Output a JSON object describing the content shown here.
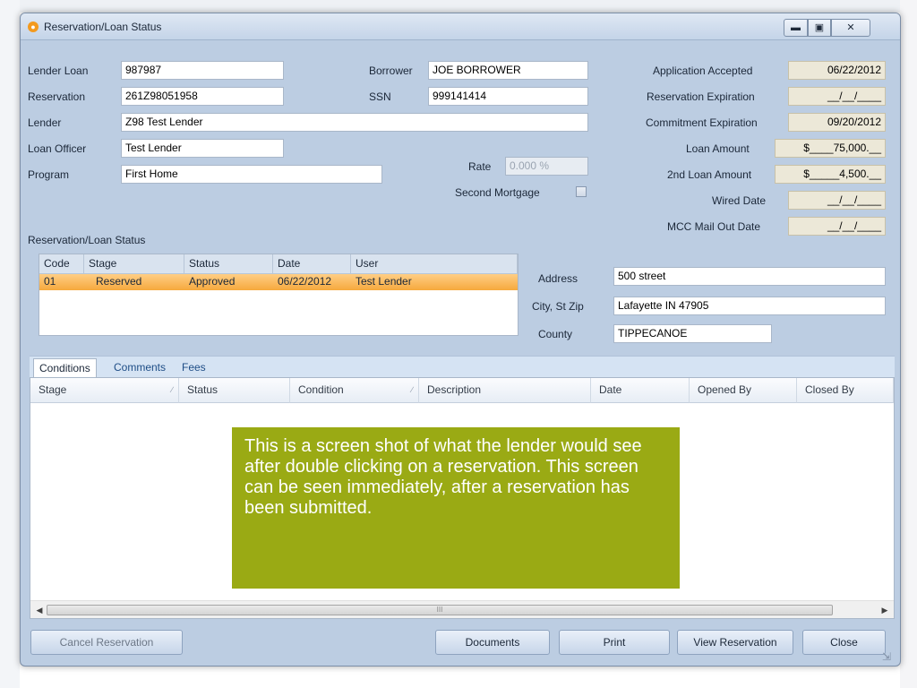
{
  "window": {
    "title": "Reservation/Loan Status",
    "controls": {
      "minimize_icon": "minimize-icon",
      "maximize_icon": "maximize-icon",
      "close_icon": "close-icon"
    }
  },
  "fields": {
    "lender_loan": {
      "label": "Lender Loan",
      "value": "987987"
    },
    "reservation": {
      "label": "Reservation",
      "value": "261Z98051958"
    },
    "lender": {
      "label": "Lender",
      "value": "Z98 Test Lender"
    },
    "loan_officer": {
      "label": "Loan Officer",
      "value": "Test Lender"
    },
    "program": {
      "label": "Program",
      "value": "First Home"
    },
    "borrower": {
      "label": "Borrower",
      "value": "JOE BORROWER"
    },
    "ssn": {
      "label": "SSN",
      "value": "999141414"
    },
    "rate": {
      "label": "Rate",
      "value": "0.000 %"
    },
    "second_mortgage": {
      "label": "Second Mortgage",
      "checked": false
    },
    "application_accepted": {
      "label": "Application Accepted",
      "value": "06/22/2012"
    },
    "reservation_expiration": {
      "label": "Reservation Expiration",
      "value": "__/__/____"
    },
    "commitment_expiration": {
      "label": "Commitment Expiration",
      "value": "09/20/2012"
    },
    "loan_amount": {
      "label": "Loan Amount",
      "value": "$____75,000.__"
    },
    "second_loan_amount": {
      "label": "2nd Loan Amount",
      "value": "$_____4,500.__"
    },
    "wired_date": {
      "label": "Wired Date",
      "value": "__/__/____"
    },
    "mcc_mail_out_date": {
      "label": "MCC Mail Out Date",
      "value": "__/__/____"
    },
    "address": {
      "label": "Address",
      "value": "500 street"
    },
    "city_st_zip": {
      "label": "City, St  Zip",
      "value": "Lafayette IN  47905"
    },
    "county": {
      "label": "County",
      "value": "TIPPECANOE"
    }
  },
  "status_section": {
    "title": "Reservation/Loan Status",
    "columns": [
      "Code",
      "Stage",
      "Status",
      "Date",
      "User"
    ],
    "rows": [
      {
        "code": "01",
        "stage": "Reserved",
        "status": "Approved",
        "date": "06/22/2012",
        "user": "Test Lender"
      }
    ]
  },
  "tabs": [
    {
      "label": "Conditions",
      "active": true
    },
    {
      "label": "Comments",
      "active": false
    },
    {
      "label": "Fees",
      "active": false
    }
  ],
  "conditions_grid": {
    "columns": [
      "Stage",
      "Status",
      "Condition",
      "Description",
      "Date",
      "Opened By",
      "Closed By"
    ],
    "rows": [],
    "scrollbar_grip": "III"
  },
  "callout": {
    "text": "This is a screen shot of what the lender would see after double clicking on a reservation.  This screen can be seen immediately, after a reservation has been submitted.",
    "color": "#9aaa14"
  },
  "buttons": {
    "cancel_reservation": "Cancel Reservation",
    "documents": "Documents",
    "print": "Print",
    "view_reservation": "View Reservation",
    "close": "Close"
  },
  "colors": {
    "window_bg": "#bccde2",
    "selected_row": "#f6a93d",
    "tab_strip": "#d5e3f3"
  }
}
